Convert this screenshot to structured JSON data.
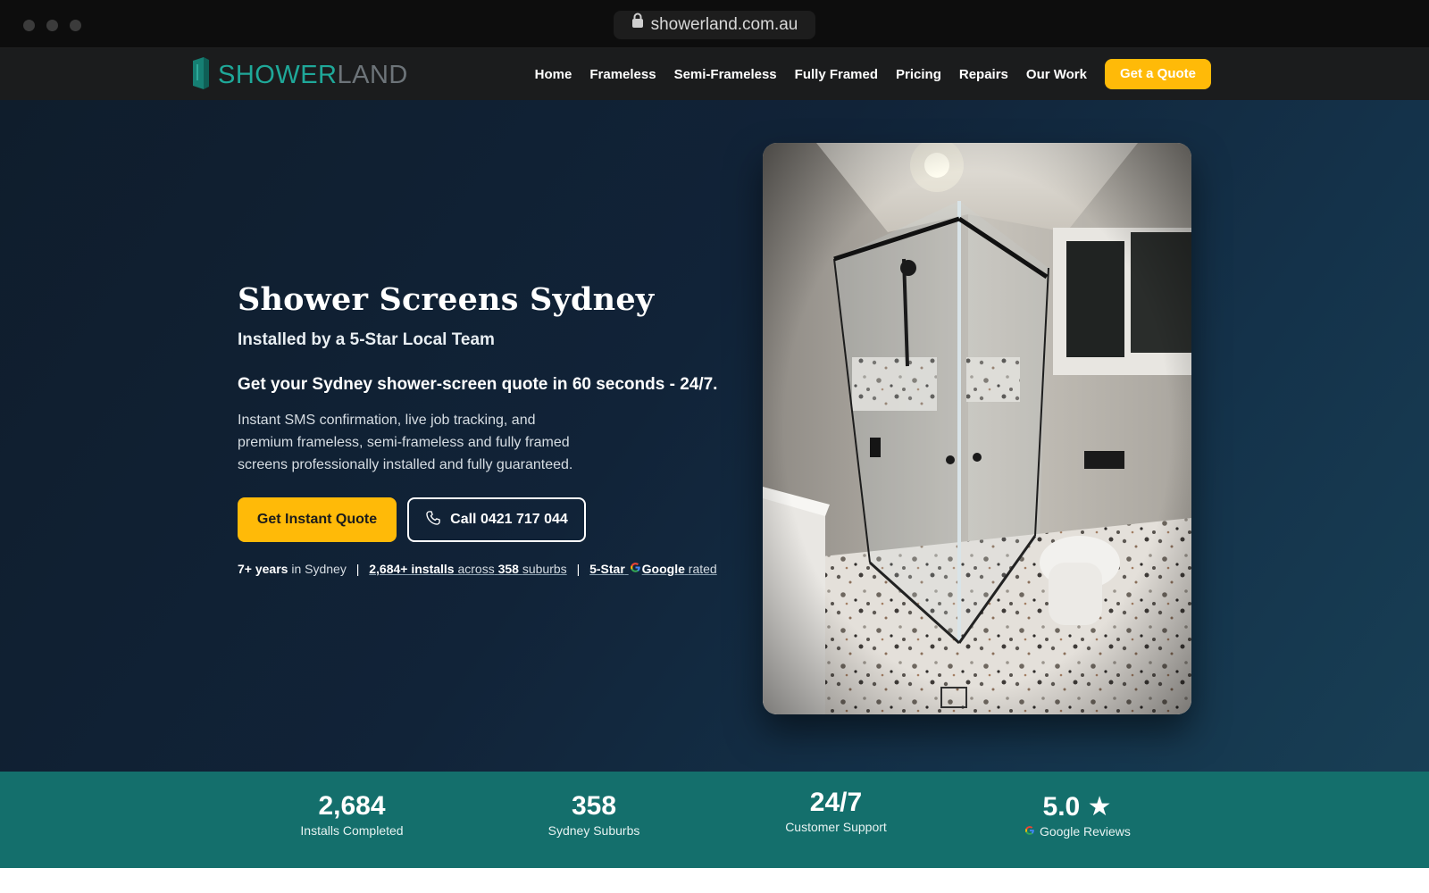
{
  "browser": {
    "url": "showerland.com.au"
  },
  "nav": {
    "logo_part1": "SHOWER",
    "logo_part2": "LAND",
    "links": [
      "Home",
      "Frameless",
      "Semi-Frameless",
      "Fully Framed",
      "Pricing",
      "Repairs",
      "Our Work"
    ],
    "cta": "Get a Quote"
  },
  "hero": {
    "title": "Shower Screens Sydney",
    "subtitle": "Installed by a 5-Star Local Team",
    "lead": "Get your Sydney shower-screen quote in 60 seconds - 24/7.",
    "description": "Instant SMS confirmation, live job tracking, and premium frameless, semi-frameless and fully framed screens professionally installed and fully guaranteed.",
    "primary_button": "Get Instant Quote",
    "call_button": "Call 0421 717 044",
    "trust": {
      "years_bold": "7+ years",
      "years_rest": "in Sydney",
      "installs_bold": "2,684+ installs",
      "installs_mid": "across",
      "suburbs_bold": "358",
      "suburbs_rest": "suburbs",
      "rating_bold": "5-Star",
      "google": "Google",
      "rated": "rated",
      "separator": "|"
    }
  },
  "stats": [
    {
      "value": "2,684",
      "label": "Installs Completed"
    },
    {
      "value": "358",
      "label": "Sydney Suburbs"
    },
    {
      "value": "24/7",
      "label": "Customer Support"
    },
    {
      "value": "5.0 ★",
      "label": "Google Reviews"
    }
  ],
  "colors": {
    "accent": "#ffba08",
    "teal": "#146f6c",
    "hero_bg": "#112338",
    "logo_teal": "#1fa899"
  },
  "icons": [
    "lock-icon",
    "logo-glass-icon",
    "phone-icon",
    "google-icon",
    "star-icon"
  ]
}
